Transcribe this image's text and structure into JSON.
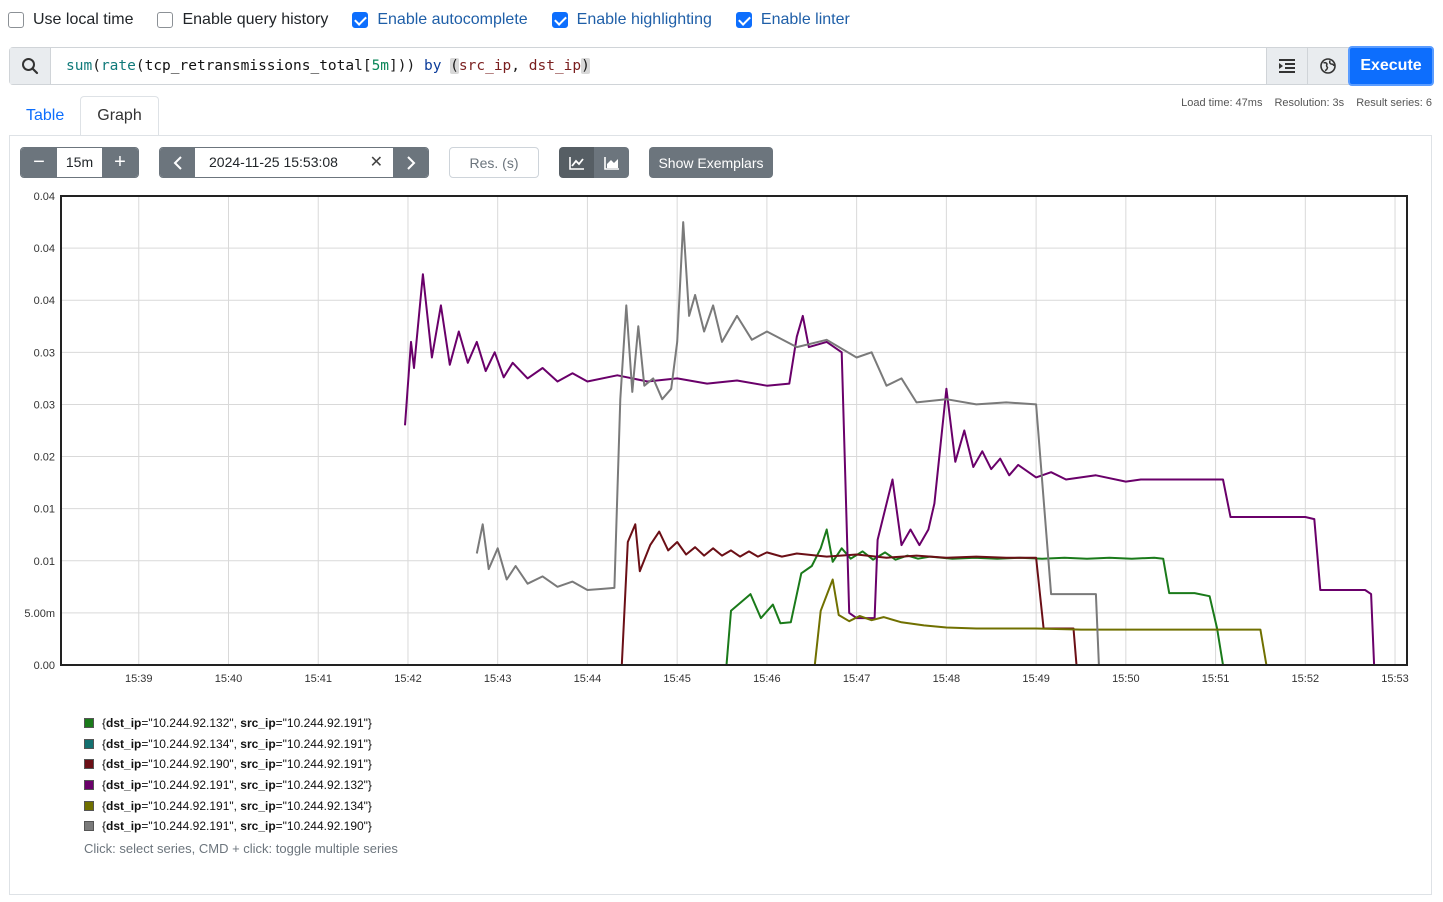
{
  "options": [
    {
      "label": "Use local time",
      "checked": false
    },
    {
      "label": "Enable query history",
      "checked": false
    },
    {
      "label": "Enable autocomplete",
      "checked": true
    },
    {
      "label": "Enable highlighting",
      "checked": true
    },
    {
      "label": "Enable linter",
      "checked": true
    }
  ],
  "query": {
    "fn1": "sum",
    "fn2": "rate",
    "metric": "tcp_retransmissions_total",
    "range": "5m",
    "by": "by",
    "label1": "src_ip",
    "label2": "dst_ip",
    "text": "sum(rate(tcp_retransmissions_total[5m])) by (src_ip, dst_ip)"
  },
  "execute_label": "Execute",
  "icons": {
    "search": "search-icon",
    "format": "format-indent-icon",
    "metrics_explorer": "globe-icon"
  },
  "tabs": {
    "table": "Table",
    "graph": "Graph",
    "active": "Graph"
  },
  "stats": {
    "load_time": "Load time: 47ms",
    "resolution": "Resolution: 3s",
    "result_series": "Result series: 6"
  },
  "controls": {
    "range_value": "15m",
    "end_time": "2024-11-25 15:53:08",
    "resolution_placeholder": "Res. (s)",
    "show_exemplars": "Show Exemplars"
  },
  "chart_data": {
    "type": "line",
    "y_tick_labels": [
      "0.00",
      "5.00m",
      "0.01",
      "0.01",
      "0.02",
      "0.03",
      "0.03",
      "0.04",
      "0.04",
      "0.04"
    ],
    "ylim": [
      0,
      0.045
    ],
    "x_tick_labels": [
      "15:39",
      "15:40",
      "15:41",
      "15:42",
      "15:43",
      "15:44",
      "15:45",
      "15:46",
      "15:47",
      "15:48",
      "15:49",
      "15:50",
      "15:51",
      "15:52",
      "15:53"
    ],
    "xlim": [
      "15:38:08",
      "15:53:08"
    ],
    "grid": true,
    "series": [
      {
        "name": "{dst_ip=\"10.244.92.132\", src_ip=\"10.244.92.191\"}",
        "color": "#1a7a1a",
        "points": [
          [
            "15:38:08",
            0
          ],
          [
            "15:45:33",
            0
          ],
          [
            "15:45:36",
            0.0052
          ],
          [
            "15:45:49",
            0.0068
          ],
          [
            "15:45:56",
            0.0045
          ],
          [
            "15:46:04",
            0.0058
          ],
          [
            "15:46:09",
            0.004
          ],
          [
            "15:46:16",
            0.0041
          ],
          [
            "15:46:23",
            0.0088
          ],
          [
            "15:46:30",
            0.0095
          ],
          [
            "15:46:36",
            0.0112
          ],
          [
            "15:46:40",
            0.013
          ],
          [
            "15:46:44",
            0.0099
          ],
          [
            "15:46:50",
            0.0112
          ],
          [
            "15:46:56",
            0.0102
          ],
          [
            "15:47:04",
            0.0109
          ],
          [
            "15:47:11",
            0.0101
          ],
          [
            "15:47:19",
            0.0108
          ],
          [
            "15:47:26",
            0.0101
          ],
          [
            "15:47:34",
            0.0105
          ],
          [
            "15:47:41",
            0.0102
          ],
          [
            "15:47:49",
            0.0104
          ],
          [
            "15:48:04",
            0.0102
          ],
          [
            "15:48:19",
            0.0103
          ],
          [
            "15:48:34",
            0.0102
          ],
          [
            "15:48:49",
            0.0103
          ],
          [
            "15:49:04",
            0.0102
          ],
          [
            "15:49:19",
            0.0103
          ],
          [
            "15:49:34",
            0.0102
          ],
          [
            "15:49:49",
            0.0103
          ],
          [
            "15:50:04",
            0.0102
          ],
          [
            "15:50:19",
            0.0103
          ],
          [
            "15:50:25",
            0.0102
          ],
          [
            "15:50:29",
            0.0069
          ],
          [
            "15:50:46",
            0.0069
          ],
          [
            "15:50:56",
            0.0066
          ],
          [
            "15:51:01",
            0.0035
          ],
          [
            "15:51:05",
            0
          ]
        ]
      },
      {
        "name": "{dst_ip=\"10.244.92.134\", src_ip=\"10.244.92.191\"}",
        "color": "#137070",
        "points": [
          [
            "15:41:50",
            0
          ],
          [
            "15:53:08",
            0
          ]
        ]
      },
      {
        "name": "{dst_ip=\"10.244.92.190\", src_ip=\"10.244.92.191\"}",
        "color": "#6b0f16",
        "points": [
          [
            "15:38:08",
            0
          ],
          [
            "15:44:23",
            0
          ],
          [
            "15:44:27",
            0.0118
          ],
          [
            "15:44:32",
            0.0135
          ],
          [
            "15:44:35",
            0.009
          ],
          [
            "15:44:42",
            0.0115
          ],
          [
            "15:44:48",
            0.0128
          ],
          [
            "15:44:54",
            0.011
          ],
          [
            "15:45:00",
            0.0118
          ],
          [
            "15:45:06",
            0.0106
          ],
          [
            "15:45:12",
            0.0113
          ],
          [
            "15:45:18",
            0.0105
          ],
          [
            "15:45:24",
            0.0112
          ],
          [
            "15:45:30",
            0.0105
          ],
          [
            "15:45:36",
            0.011
          ],
          [
            "15:45:42",
            0.0104
          ],
          [
            "15:45:48",
            0.0109
          ],
          [
            "15:45:54",
            0.0104
          ],
          [
            "15:46:00",
            0.0108
          ],
          [
            "15:46:10",
            0.0104
          ],
          [
            "15:46:20",
            0.0107
          ],
          [
            "15:46:40",
            0.0104
          ],
          [
            "15:47:00",
            0.0106
          ],
          [
            "15:47:20",
            0.0103
          ],
          [
            "15:47:40",
            0.0105
          ],
          [
            "15:48:00",
            0.0103
          ],
          [
            "15:48:20",
            0.0104
          ],
          [
            "15:48:40",
            0.0103
          ],
          [
            "15:49:00",
            0.0103
          ],
          [
            "15:49:05",
            0.0035
          ],
          [
            "15:49:20",
            0.0035
          ],
          [
            "15:49:25",
            0.0035
          ],
          [
            "15:49:27",
            0
          ]
        ]
      },
      {
        "name": "{dst_ip=\"10.244.92.191\", src_ip=\"10.244.92.132\"}",
        "color": "#6a006a",
        "points": [
          [
            "15:41:58",
            0.023
          ],
          [
            "15:42:02",
            0.031
          ],
          [
            "15:42:04",
            0.0285
          ],
          [
            "15:42:10",
            0.0375
          ],
          [
            "15:42:16",
            0.0295
          ],
          [
            "15:42:22",
            0.0345
          ],
          [
            "15:42:28",
            0.0288
          ],
          [
            "15:42:34",
            0.032
          ],
          [
            "15:42:40",
            0.029
          ],
          [
            "15:42:46",
            0.031
          ],
          [
            "15:42:52",
            0.0282
          ],
          [
            "15:42:58",
            0.03
          ],
          [
            "15:43:04",
            0.0276
          ],
          [
            "15:43:10",
            0.029
          ],
          [
            "15:43:20",
            0.0275
          ],
          [
            "15:43:30",
            0.0285
          ],
          [
            "15:43:40",
            0.0272
          ],
          [
            "15:43:50",
            0.028
          ],
          [
            "15:44:00",
            0.0272
          ],
          [
            "15:44:20",
            0.0278
          ],
          [
            "15:44:40",
            0.0272
          ],
          [
            "15:45:00",
            0.0275
          ],
          [
            "15:45:20",
            0.027
          ],
          [
            "15:45:40",
            0.0273
          ],
          [
            "15:46:00",
            0.0268
          ],
          [
            "15:46:15",
            0.027
          ],
          [
            "15:46:20",
            0.0315
          ],
          [
            "15:46:24",
            0.0335
          ],
          [
            "15:46:28",
            0.0305
          ],
          [
            "15:46:40",
            0.031
          ],
          [
            "15:46:50",
            0.03
          ],
          [
            "15:46:55",
            0.005
          ],
          [
            "15:47:00",
            0.0045
          ],
          [
            "15:47:12",
            0.0045
          ],
          [
            "15:47:14",
            0.012
          ],
          [
            "15:47:24",
            0.0178
          ],
          [
            "15:47:30",
            0.0115
          ],
          [
            "15:47:36",
            0.013
          ],
          [
            "15:47:42",
            0.0115
          ],
          [
            "15:47:48",
            0.013
          ],
          [
            "15:47:52",
            0.0155
          ],
          [
            "15:48:00",
            0.0265
          ],
          [
            "15:48:06",
            0.0195
          ],
          [
            "15:48:12",
            0.0225
          ],
          [
            "15:48:18",
            0.019
          ],
          [
            "15:48:24",
            0.0205
          ],
          [
            "15:48:30",
            0.0188
          ],
          [
            "15:48:36",
            0.0198
          ],
          [
            "15:48:42",
            0.0182
          ],
          [
            "15:48:48",
            0.0192
          ],
          [
            "15:49:00",
            0.018
          ],
          [
            "15:49:10",
            0.0185
          ],
          [
            "15:49:20",
            0.0178
          ],
          [
            "15:49:40",
            0.0182
          ],
          [
            "15:50:00",
            0.0176
          ],
          [
            "15:50:10",
            0.0178
          ],
          [
            "15:51:05",
            0.0178
          ],
          [
            "15:51:10",
            0.0142
          ],
          [
            "15:52:00",
            0.0142
          ],
          [
            "15:52:06",
            0.014
          ],
          [
            "15:52:10",
            0.0072
          ],
          [
            "15:52:40",
            0.0072
          ],
          [
            "15:52:44",
            0.0068
          ],
          [
            "15:52:46",
            0
          ]
        ]
      },
      {
        "name": "{dst_ip=\"10.244.92.191\", src_ip=\"10.244.92.134\"}",
        "color": "#707000",
        "points": [
          [
            "15:38:08",
            0
          ],
          [
            "15:46:32",
            0
          ],
          [
            "15:46:36",
            0.0052
          ],
          [
            "15:46:44",
            0.0082
          ],
          [
            "15:46:48",
            0.0048
          ],
          [
            "15:46:55",
            0.0042
          ],
          [
            "15:47:02",
            0.0047
          ],
          [
            "15:47:10",
            0.0043
          ],
          [
            "15:47:18",
            0.0046
          ],
          [
            "15:47:30",
            0.0041
          ],
          [
            "15:47:45",
            0.0038
          ],
          [
            "15:48:00",
            0.0036
          ],
          [
            "15:48:20",
            0.0035
          ],
          [
            "15:49:00",
            0.0035
          ],
          [
            "15:49:30",
            0.0034
          ],
          [
            "15:50:00",
            0.0034
          ],
          [
            "15:51:00",
            0.0034
          ],
          [
            "15:51:30",
            0.0034
          ],
          [
            "15:51:34",
            0
          ]
        ]
      },
      {
        "name": "{dst_ip=\"10.244.92.191\", src_ip=\"10.244.92.190\"}",
        "color": "#7a7a7a",
        "points": [
          [
            "15:42:46",
            0.0107
          ],
          [
            "15:42:50",
            0.0135
          ],
          [
            "15:42:54",
            0.0092
          ],
          [
            "15:43:00",
            0.0112
          ],
          [
            "15:43:06",
            0.0082
          ],
          [
            "15:43:12",
            0.0095
          ],
          [
            "15:43:20",
            0.0078
          ],
          [
            "15:43:30",
            0.0085
          ],
          [
            "15:43:40",
            0.0075
          ],
          [
            "15:43:50",
            0.008
          ],
          [
            "15:44:00",
            0.0072
          ],
          [
            "15:44:10",
            0.0073
          ],
          [
            "15:44:18",
            0.0074
          ],
          [
            "15:44:22",
            0.0255
          ],
          [
            "15:44:26",
            0.0345
          ],
          [
            "15:44:30",
            0.0262
          ],
          [
            "15:44:34",
            0.0325
          ],
          [
            "15:44:38",
            0.0268
          ],
          [
            "15:44:44",
            0.0275
          ],
          [
            "15:44:50",
            0.0255
          ],
          [
            "15:44:56",
            0.0265
          ],
          [
            "15:45:00",
            0.031
          ],
          [
            "15:45:04",
            0.0425
          ],
          [
            "15:45:08",
            0.0335
          ],
          [
            "15:45:12",
            0.0355
          ],
          [
            "15:45:18",
            0.032
          ],
          [
            "15:45:24",
            0.0345
          ],
          [
            "15:45:30",
            0.031
          ],
          [
            "15:45:40",
            0.0335
          ],
          [
            "15:45:50",
            0.0312
          ],
          [
            "15:46:00",
            0.032
          ],
          [
            "15:46:20",
            0.0305
          ],
          [
            "15:46:40",
            0.0312
          ],
          [
            "15:47:00",
            0.0295
          ],
          [
            "15:47:10",
            0.03
          ],
          [
            "15:47:20",
            0.0268
          ],
          [
            "15:47:30",
            0.0275
          ],
          [
            "15:47:40",
            0.0252
          ],
          [
            "15:48:00",
            0.0255
          ],
          [
            "15:48:20",
            0.025
          ],
          [
            "15:48:40",
            0.0252
          ],
          [
            "15:49:00",
            0.025
          ],
          [
            "15:49:10",
            0.0068
          ],
          [
            "15:49:30",
            0.0068
          ],
          [
            "15:49:40",
            0.0068
          ],
          [
            "15:49:42",
            0
          ]
        ]
      }
    ]
  },
  "hint": "Click: select series, CMD + click: toggle multiple series"
}
